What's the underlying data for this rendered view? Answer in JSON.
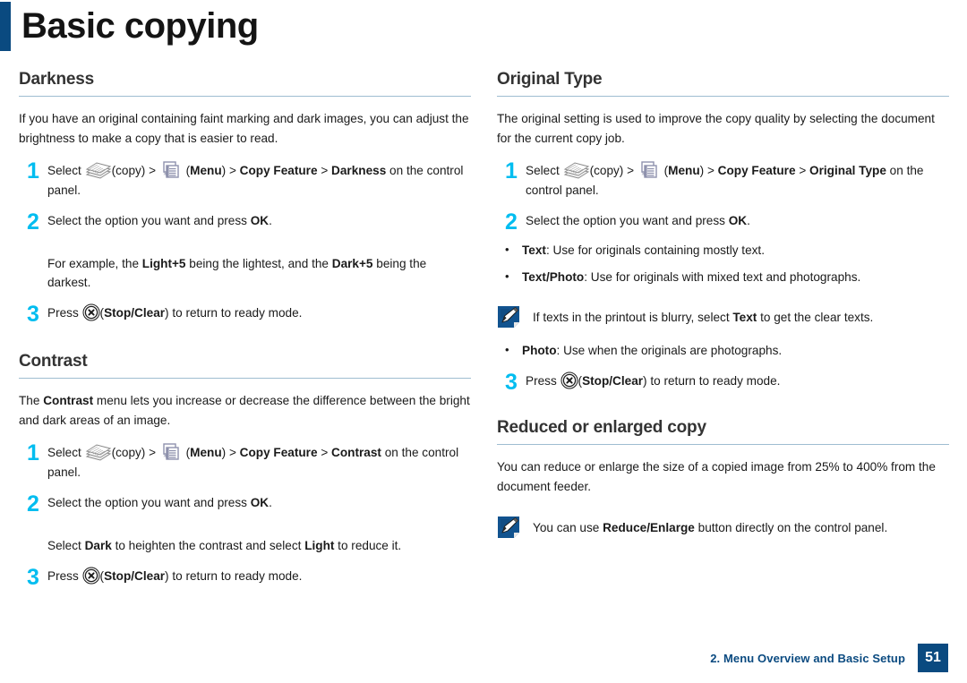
{
  "title": "Basic copying",
  "colors": {
    "accent_bar": "#0a4a80",
    "step_number": "#00bdf0",
    "heading_rule": "#9fbdd1",
    "footer_blue": "#0a4a80"
  },
  "left_column": {
    "sections": [
      {
        "heading": "Darkness",
        "intro": "If you have an original containing faint marking and dark images, you can adjust the brightness to make a copy that is easier to read.",
        "steps": [
          {
            "number": "1",
            "parts": [
              {
                "t": "text",
                "v": "Select "
              },
              {
                "t": "icon",
                "v": "copy-icon"
              },
              {
                "t": "text",
                "v": "(copy) > "
              },
              {
                "t": "icon",
                "v": "menu-icon"
              },
              {
                "t": "text",
                "v": " ("
              },
              {
                "t": "bold",
                "v": "Menu"
              },
              {
                "t": "text",
                "v": ") > "
              },
              {
                "t": "bold",
                "v": "Copy Feature"
              },
              {
                "t": "text",
                "v": " > "
              },
              {
                "t": "bold",
                "v": "Darkness"
              },
              {
                "t": "text",
                "v": " on the control panel."
              }
            ]
          },
          {
            "number": "2",
            "parts": [
              {
                "t": "text",
                "v": "Select the option you want and press "
              },
              {
                "t": "bold",
                "v": "OK"
              },
              {
                "t": "text",
                "v": "."
              }
            ],
            "extra": [
              {
                "t": "text",
                "v": "For example, the "
              },
              {
                "t": "bold",
                "v": "Light+5"
              },
              {
                "t": "text",
                "v": " being the lightest, and the "
              },
              {
                "t": "bold",
                "v": "Dark+5"
              },
              {
                "t": "text",
                "v": " being the darkest."
              }
            ]
          },
          {
            "number": "3",
            "parts": [
              {
                "t": "text",
                "v": "Press "
              },
              {
                "t": "icon",
                "v": "stop-clear-icon"
              },
              {
                "t": "text",
                "v": "("
              },
              {
                "t": "bold",
                "v": "Stop/Clear"
              },
              {
                "t": "text",
                "v": ") to return to ready mode."
              }
            ]
          }
        ]
      },
      {
        "heading": "Contrast",
        "intro_parts": [
          {
            "t": "text",
            "v": "The "
          },
          {
            "t": "bold",
            "v": "Contrast"
          },
          {
            "t": "text",
            "v": " menu lets you increase or decrease the difference between the bright and dark areas of an image."
          }
        ],
        "steps": [
          {
            "number": "1",
            "parts": [
              {
                "t": "text",
                "v": "Select "
              },
              {
                "t": "icon",
                "v": "copy-icon"
              },
              {
                "t": "text",
                "v": "(copy) > "
              },
              {
                "t": "icon",
                "v": "menu-icon"
              },
              {
                "t": "text",
                "v": " ("
              },
              {
                "t": "bold",
                "v": "Menu"
              },
              {
                "t": "text",
                "v": ") > "
              },
              {
                "t": "bold",
                "v": "Copy Feature"
              },
              {
                "t": "text",
                "v": " > "
              },
              {
                "t": "bold",
                "v": "Contrast"
              },
              {
                "t": "text",
                "v": " on the control panel."
              }
            ]
          },
          {
            "number": "2",
            "parts": [
              {
                "t": "text",
                "v": "Select the option you want and press "
              },
              {
                "t": "bold",
                "v": "OK"
              },
              {
                "t": "text",
                "v": "."
              }
            ],
            "extra": [
              {
                "t": "text",
                "v": "Select "
              },
              {
                "t": "bold",
                "v": "Dark"
              },
              {
                "t": "text",
                "v": " to heighten the contrast and select "
              },
              {
                "t": "bold",
                "v": "Light"
              },
              {
                "t": "text",
                "v": " to reduce it."
              }
            ]
          },
          {
            "number": "3",
            "parts": [
              {
                "t": "text",
                "v": "Press "
              },
              {
                "t": "icon",
                "v": "stop-clear-icon"
              },
              {
                "t": "text",
                "v": "("
              },
              {
                "t": "bold",
                "v": "Stop/Clear"
              },
              {
                "t": "text",
                "v": ") to return to ready mode."
              }
            ]
          }
        ]
      }
    ]
  },
  "right_column": {
    "sections": [
      {
        "heading": "Original Type",
        "intro": "The original setting is used to improve the copy quality by selecting the document for the current copy job.",
        "steps": [
          {
            "number": "1",
            "parts": [
              {
                "t": "text",
                "v": "Select "
              },
              {
                "t": "icon",
                "v": "copy-icon"
              },
              {
                "t": "text",
                "v": "(copy) > "
              },
              {
                "t": "icon",
                "v": "menu-icon"
              },
              {
                "t": "text",
                "v": " ("
              },
              {
                "t": "bold",
                "v": "Menu"
              },
              {
                "t": "text",
                "v": ") > "
              },
              {
                "t": "bold",
                "v": "Copy Feature"
              },
              {
                "t": "text",
                "v": " > "
              },
              {
                "t": "bold",
                "v": "Original Type"
              },
              {
                "t": "text",
                "v": " on the control panel."
              }
            ]
          },
          {
            "number": "2",
            "parts": [
              {
                "t": "text",
                "v": "Select the option you want and press "
              },
              {
                "t": "bold",
                "v": "OK"
              },
              {
                "t": "text",
                "v": "."
              }
            ]
          }
        ],
        "bullets_top": [
          {
            "dot": "•",
            "parts": [
              {
                "t": "bold",
                "v": "Text"
              },
              {
                "t": "text",
                "v": ": Use for originals containing mostly text."
              }
            ]
          },
          {
            "dot": "•",
            "parts": [
              {
                "t": "bold",
                "v": "Text/Photo"
              },
              {
                "t": "text",
                "v": ": Use for originals with mixed text and photographs."
              }
            ]
          }
        ],
        "note": {
          "icon": "note-pencil-icon",
          "parts": [
            {
              "t": "text",
              "v": "If texts in the printout is blurry, select "
            },
            {
              "t": "bold",
              "v": "Text"
            },
            {
              "t": "text",
              "v": " to get the clear texts."
            }
          ]
        },
        "bullets_bottom": [
          {
            "dot": "•",
            "parts": [
              {
                "t": "bold",
                "v": "Photo"
              },
              {
                "t": "text",
                "v": ": Use when the originals are photographs."
              }
            ]
          }
        ],
        "final_step": {
          "number": "3",
          "parts": [
            {
              "t": "text",
              "v": "Press "
            },
            {
              "t": "icon",
              "v": "stop-clear-icon"
            },
            {
              "t": "text",
              "v": "("
            },
            {
              "t": "bold",
              "v": "Stop/Clear"
            },
            {
              "t": "text",
              "v": ") to return to ready mode."
            }
          ]
        }
      },
      {
        "heading": "Reduced or enlarged copy",
        "intro": "You can reduce or enlarge the size of a copied image from 25% to 400% from the document feeder.",
        "note": {
          "icon": "note-pencil-icon",
          "parts": [
            {
              "t": "text",
              "v": "You can use "
            },
            {
              "t": "bold",
              "v": "Reduce/Enlarge"
            },
            {
              "t": "text",
              "v": " button directly on the control panel."
            }
          ]
        }
      }
    ]
  },
  "footer": {
    "chapter": "2.  Menu Overview and Basic Setup",
    "page_number": "51"
  }
}
